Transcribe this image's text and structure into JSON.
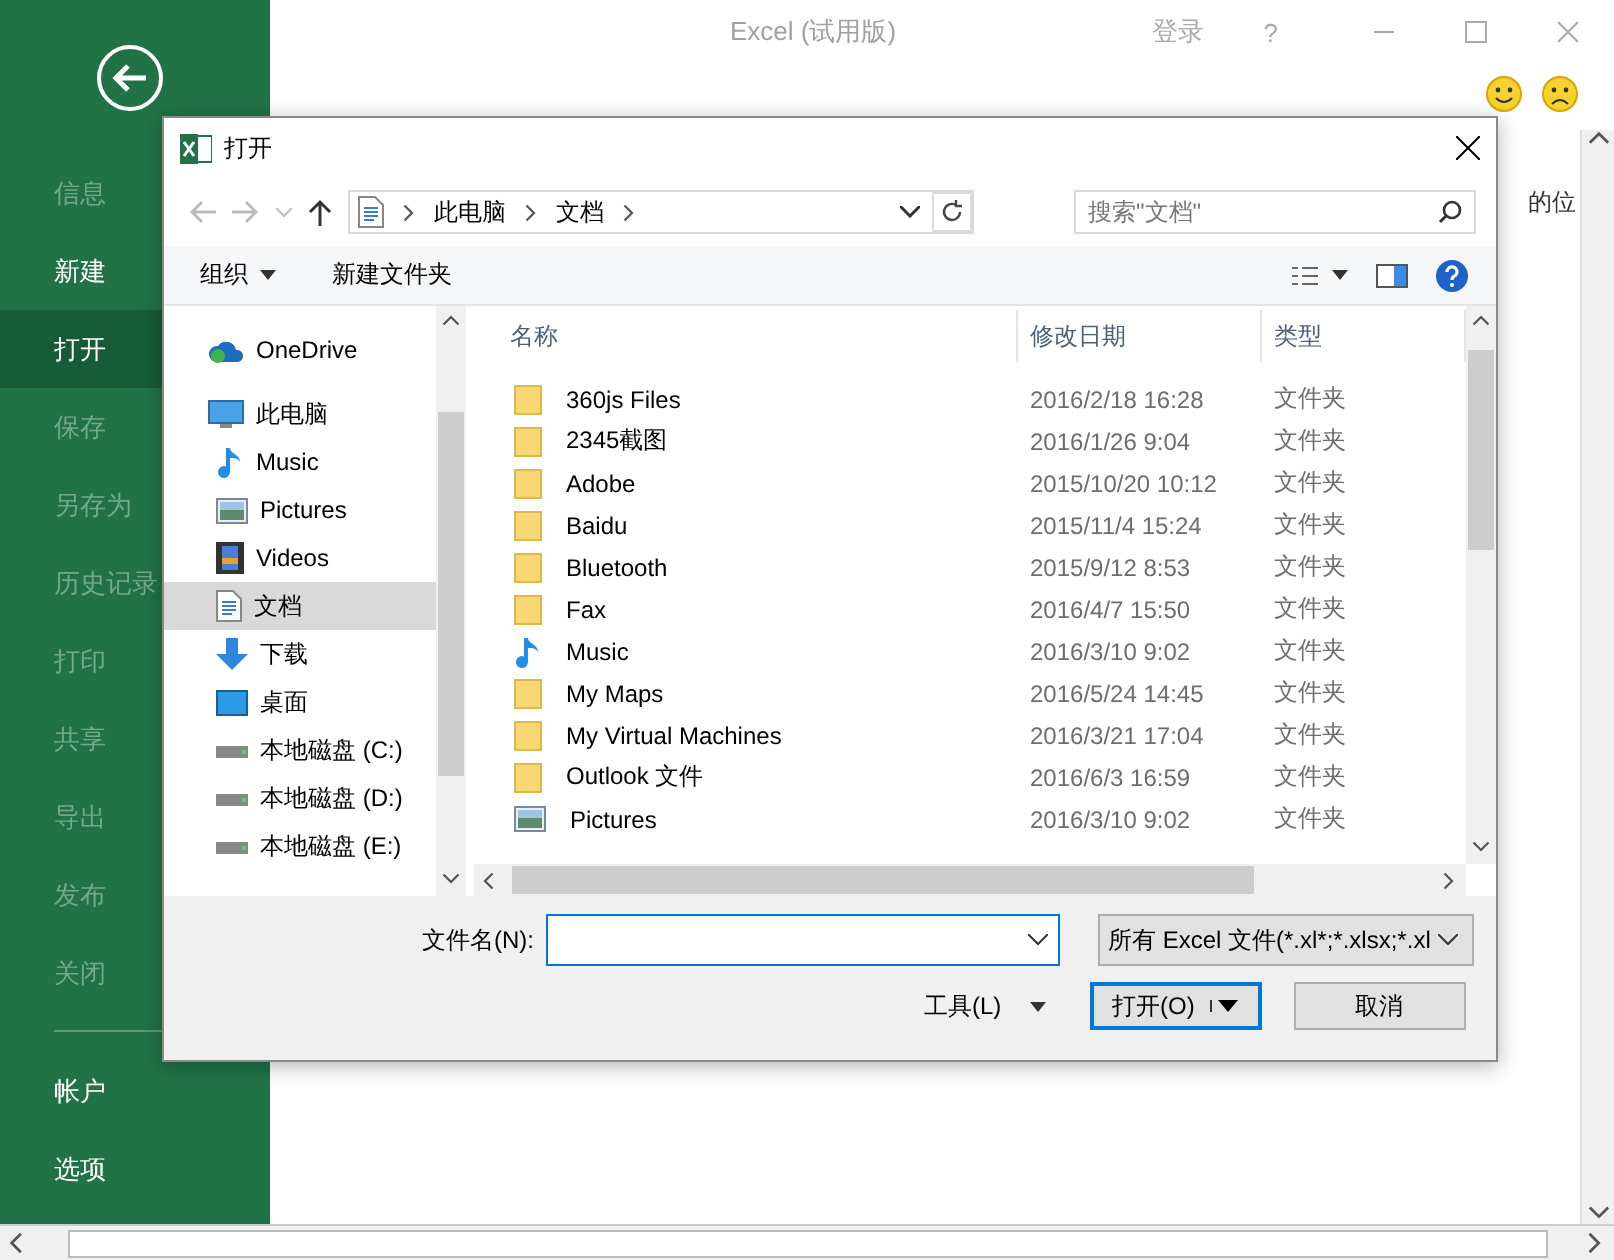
{
  "window": {
    "title": "Excel (试用版)",
    "sign_in": "登录",
    "help": "?"
  },
  "backstage": {
    "items": [
      {
        "label": "信息",
        "disabled": true,
        "selected": false
      },
      {
        "label": "新建",
        "disabled": false,
        "selected": false
      },
      {
        "label": "打开",
        "disabled": false,
        "selected": true
      },
      {
        "label": "保存",
        "disabled": true,
        "selected": false
      },
      {
        "label": "另存为",
        "disabled": true,
        "selected": false
      },
      {
        "label": "历史记录",
        "disabled": true,
        "selected": false
      },
      {
        "label": "打印",
        "disabled": true,
        "selected": false
      },
      {
        "label": "共享",
        "disabled": true,
        "selected": false
      },
      {
        "label": "导出",
        "disabled": true,
        "selected": false
      },
      {
        "label": "发布",
        "disabled": true,
        "selected": false
      },
      {
        "label": "关闭",
        "disabled": true,
        "selected": false
      }
    ],
    "footer_items": [
      {
        "label": "帐户",
        "disabled": false,
        "selected": false
      },
      {
        "label": "选项",
        "disabled": false,
        "selected": false
      }
    ]
  },
  "background_text": "的位",
  "dialog": {
    "title": "打开",
    "breadcrumb": [
      "此电脑",
      "文档"
    ],
    "search": {
      "placeholder": "搜索\"文档\""
    },
    "toolbar": {
      "organize": "组织",
      "new_folder": "新建文件夹"
    },
    "nav": [
      {
        "label": "OneDrive",
        "kind": "onedrive",
        "selected": false
      },
      {
        "label": "此电脑",
        "kind": "pc",
        "selected": false,
        "children": [
          {
            "label": "Music",
            "kind": "music",
            "selected": false
          },
          {
            "label": "Pictures",
            "kind": "pictures",
            "selected": false
          },
          {
            "label": "Videos",
            "kind": "videos",
            "selected": false
          },
          {
            "label": "文档",
            "kind": "documents",
            "selected": true
          },
          {
            "label": "下载",
            "kind": "downloads",
            "selected": false
          },
          {
            "label": "桌面",
            "kind": "desktop",
            "selected": false
          },
          {
            "label": "本地磁盘 (C:)",
            "kind": "drive",
            "selected": false
          },
          {
            "label": "本地磁盘 (D:)",
            "kind": "drive",
            "selected": false
          },
          {
            "label": "本地磁盘 (E:)",
            "kind": "drive",
            "selected": false
          }
        ]
      }
    ],
    "columns": [
      "名称",
      "修改日期",
      "类型"
    ],
    "rows": [
      {
        "name": "360js Files",
        "date": "2016/2/18 16:28",
        "type": "文件夹",
        "kind": "folder"
      },
      {
        "name": "2345截图",
        "date": "2016/1/26 9:04",
        "type": "文件夹",
        "kind": "folder"
      },
      {
        "name": "Adobe",
        "date": "2015/10/20 10:12",
        "type": "文件夹",
        "kind": "folder"
      },
      {
        "name": "Baidu",
        "date": "2015/11/4 15:24",
        "type": "文件夹",
        "kind": "folder"
      },
      {
        "name": "Bluetooth",
        "date": "2015/9/12 8:53",
        "type": "文件夹",
        "kind": "folder"
      },
      {
        "name": "Fax",
        "date": "2016/4/7 15:50",
        "type": "文件夹",
        "kind": "folder"
      },
      {
        "name": "Music",
        "date": "2016/3/10 9:02",
        "type": "文件夹",
        "kind": "music"
      },
      {
        "name": "My Maps",
        "date": "2016/5/24 14:45",
        "type": "文件夹",
        "kind": "folder"
      },
      {
        "name": "My Virtual Machines",
        "date": "2016/3/21 17:04",
        "type": "文件夹",
        "kind": "folder"
      },
      {
        "name": "Outlook 文件",
        "date": "2016/6/3 16:59",
        "type": "文件夹",
        "kind": "folder"
      },
      {
        "name": "Pictures",
        "date": "2016/3/10 9:02",
        "type": "文件夹",
        "kind": "pictures"
      }
    ],
    "filename": {
      "label": "文件名(N):"
    },
    "filter": "所有 Excel 文件(*.xl*;*.xlsx;*.xl",
    "tools": "工具(L)",
    "open": "打开(O)",
    "cancel": "取消"
  }
}
